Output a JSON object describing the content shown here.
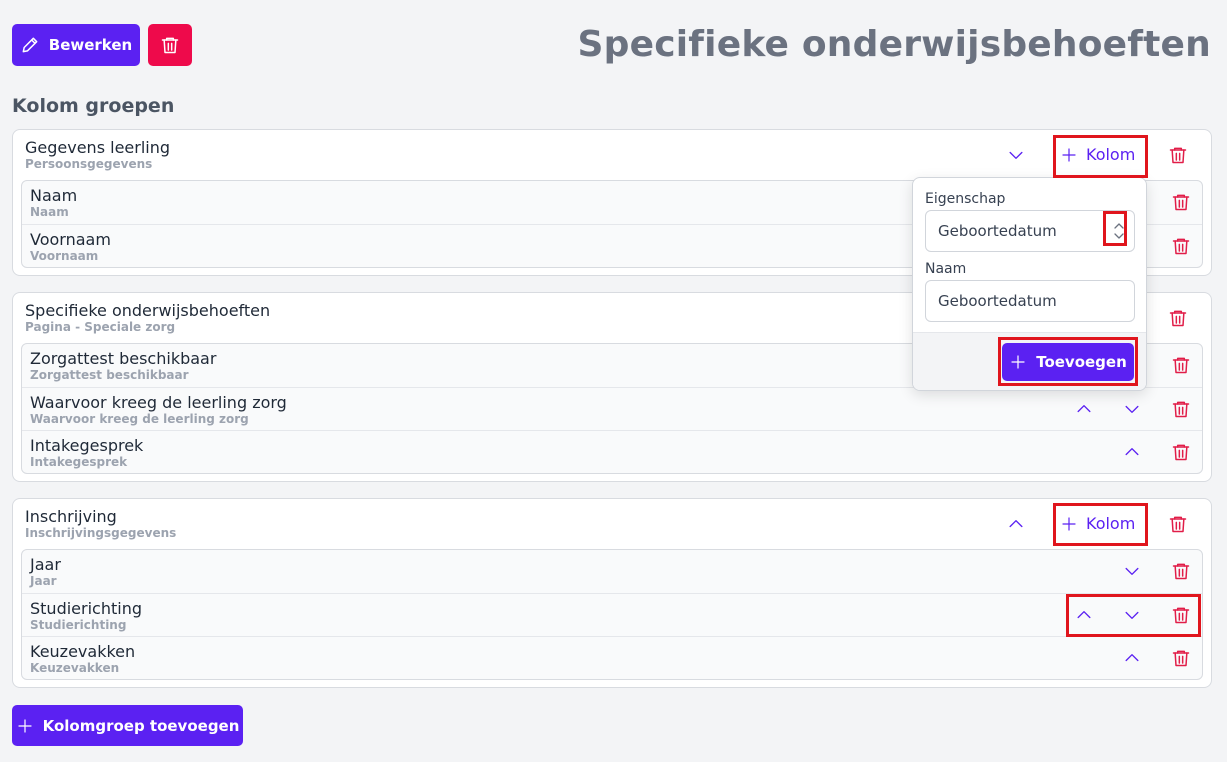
{
  "toolbar": {
    "edit_label": "Bewerken"
  },
  "page": {
    "title": "Specifieke onderwijsbehoeften",
    "section_title": "Kolom groepen"
  },
  "groups": [
    {
      "name": "Gegevens leerling",
      "subtitle": "Persoonsgegevens",
      "columns": [
        {
          "name": "Naam",
          "sub": "Naam"
        },
        {
          "name": "Voornaam",
          "sub": "Voornaam"
        }
      ]
    },
    {
      "name": "Specifieke onderwijsbehoeften",
      "subtitle": "Pagina - Speciale zorg",
      "columns": [
        {
          "name": "Zorgattest beschikbaar",
          "sub": "Zorgattest beschikbaar"
        },
        {
          "name": "Waarvoor kreeg de leerling zorg",
          "sub": "Waarvoor kreeg de leerling zorg"
        },
        {
          "name": "Intakegesprek",
          "sub": "Intakegesprek"
        }
      ]
    },
    {
      "name": "Inschrijving",
      "subtitle": "Inschrijvingsgegevens",
      "columns": [
        {
          "name": "Jaar",
          "sub": "Jaar"
        },
        {
          "name": "Studierichting",
          "sub": "Studierichting"
        },
        {
          "name": "Keuzevakken",
          "sub": "Keuzevakken"
        }
      ]
    }
  ],
  "kolom_label": "Kolom",
  "popup": {
    "property_label": "Eigenschap",
    "property_value": "Geboortedatum",
    "name_label": "Naam",
    "name_value": "Geboortedatum",
    "add_label": "Toevoegen"
  },
  "add_group_label": "Kolomgroep toevoegen",
  "colors": {
    "primary": "#5b21f2",
    "danger": "#ee0a4b",
    "highlight": "#e0151d"
  },
  "icons": {
    "edit": "pencil-icon",
    "delete": "trash-icon",
    "add": "plus-icon",
    "up": "chevron-up-icon",
    "down": "chevron-down-icon",
    "select": "select-arrows-icon"
  }
}
